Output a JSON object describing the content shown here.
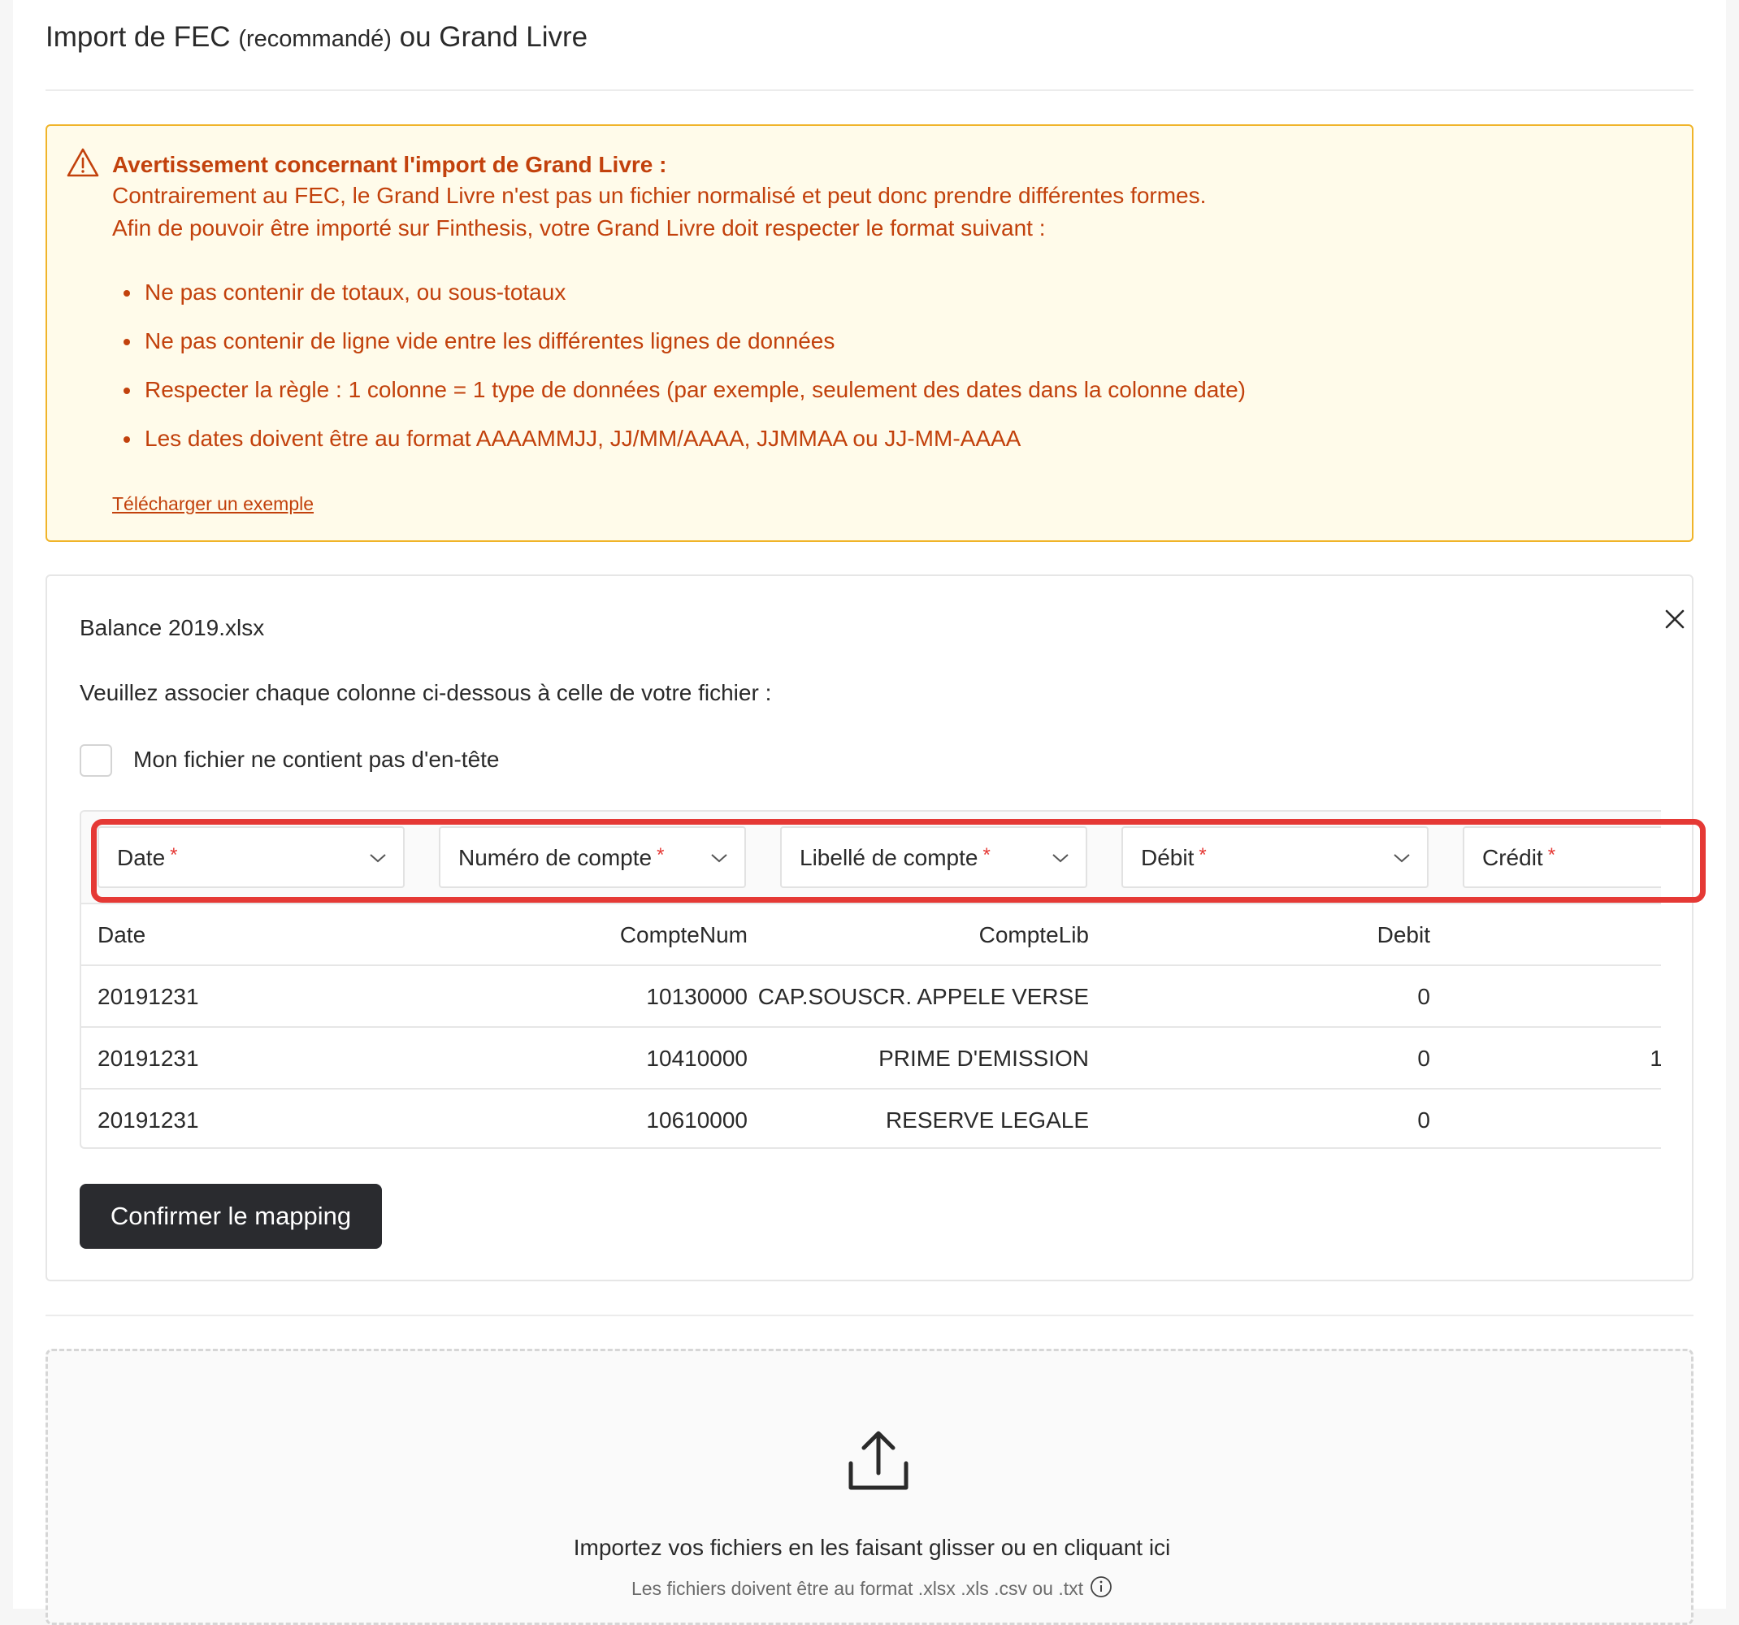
{
  "header": {
    "title_part1": "Import de FEC",
    "title_small": "(recommandé)",
    "title_part2": "ou Grand Livre"
  },
  "warning": {
    "icon": "warning-triangle-icon",
    "title": "Avertissement concernant l'import de Grand Livre :",
    "line1": "Contrairement au FEC, le Grand Livre n'est pas un fichier normalisé et peut donc prendre différentes formes.",
    "line2": "Afin de pouvoir être importé sur Finthesis, votre Grand Livre doit respecter le format suivant :",
    "rules": [
      "Ne pas contenir de totaux, ou sous-totaux",
      "Ne pas contenir de ligne vide entre les différentes lignes de données",
      "Respecter la règle : 1 colonne = 1 type de données (par exemple, seulement des dates dans la colonne date)",
      "Les dates doivent être au format AAAAMMJJ, JJ/MM/AAAA, JJMMAA ou JJ-MM-AAAA"
    ],
    "link": "Télécharger un exemple",
    "colors": {
      "background": "#fffbea",
      "border": "#f0b429",
      "text": "#c2410c"
    }
  },
  "mapping": {
    "filename": "Balance 2019.xlsx",
    "close_icon": "close-icon",
    "instruction": "Veuillez associer chaque colonne ci-dessous à celle de votre fichier :",
    "no_header_checkbox": {
      "label": "Mon fichier ne contient pas d'en-tête",
      "checked": false
    },
    "selects": [
      {
        "label": "Date",
        "required_mark": "*"
      },
      {
        "label": "Numéro de compte",
        "required_mark": "*"
      },
      {
        "label": "Libellé de compte",
        "required_mark": "*"
      },
      {
        "label": "Débit",
        "required_mark": "*"
      },
      {
        "label": "Crédit",
        "required_mark": "*"
      }
    ],
    "table": {
      "headers": [
        "Date",
        "CompteNum",
        "CompteLib",
        "Debit",
        ""
      ],
      "rows": [
        [
          "20191231",
          "10130000",
          "CAP.SOUSCR. APPELE VERSE",
          "0",
          ""
        ],
        [
          "20191231",
          "10410000",
          "PRIME D'EMISSION",
          "0",
          "1"
        ],
        [
          "20191231",
          "10610000",
          "RESERVE LEGALE",
          "0",
          ""
        ]
      ]
    },
    "confirm_button": "Confirmer le mapping",
    "highlight_color": "#e53935"
  },
  "dropzone": {
    "icon": "upload-icon",
    "title": "Importez vos fichiers en les faisant glisser ou en cliquant ici",
    "subtitle": "Les fichiers doivent être au format .xlsx .xls .csv ou .txt",
    "info_icon": "info-icon"
  }
}
